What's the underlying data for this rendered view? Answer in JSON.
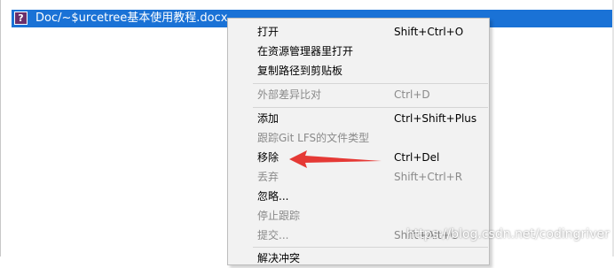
{
  "file_row": {
    "icon_glyph": "?",
    "icon_name": "unknown-file-icon",
    "name": "Doc/~$urcetree基本使用教程.docx",
    "highlight_color": "#1a72d6"
  },
  "menu": {
    "items": [
      {
        "label": "打开",
        "shortcut": "Shift+Ctrl+O",
        "enabled": true
      },
      {
        "label": "在资源管理器里打开",
        "shortcut": "",
        "enabled": true
      },
      {
        "label": "复制路径到剪贴板",
        "shortcut": "",
        "enabled": true
      },
      {
        "label": "外部差异比对",
        "shortcut": "Ctrl+D",
        "enabled": false
      },
      {
        "label": "添加",
        "shortcut": "Ctrl+Shift+Plus",
        "enabled": true
      },
      {
        "label": "跟踪Git LFS的文件类型",
        "shortcut": "",
        "enabled": false
      },
      {
        "label": "移除",
        "shortcut": "Ctrl+Del",
        "enabled": true
      },
      {
        "label": "丢弃",
        "shortcut": "Shift+Ctrl+R",
        "enabled": false
      },
      {
        "label": "忽略...",
        "shortcut": "",
        "enabled": true
      },
      {
        "label": "停止跟踪",
        "shortcut": "",
        "enabled": false
      },
      {
        "label": "提交...",
        "shortcut": "Shift+Alt+C",
        "enabled": false
      },
      {
        "label": "解决冲突",
        "shortcut": "",
        "enabled": true
      }
    ]
  },
  "annotation": {
    "color": "#e53935"
  },
  "watermark": "https://blog.csdn.net/codingriver"
}
